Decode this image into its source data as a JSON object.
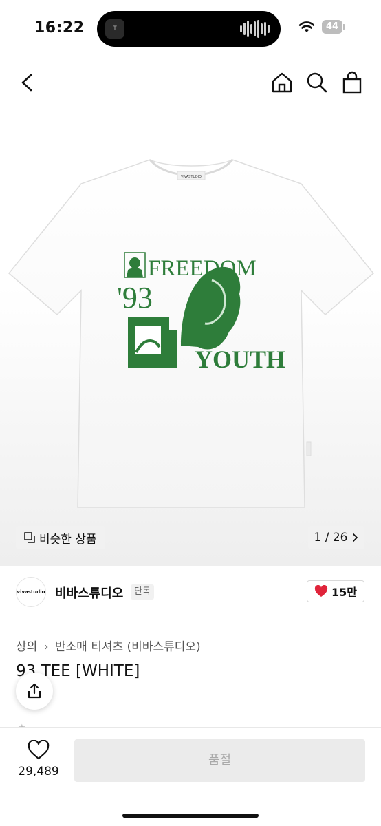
{
  "status_bar": {
    "time": "16:22",
    "battery": "44",
    "wifi_icon": "wifi-icon",
    "island_app_label": "T"
  },
  "nav": {
    "back_icon": "chevron-left-icon",
    "home_icon": "home-icon",
    "search_icon": "search-icon",
    "bag_icon": "shopping-bag-icon"
  },
  "product_image": {
    "neck_label": "VIVASTUDIO",
    "print_text_top": "FREEDOM",
    "print_number": "'93",
    "print_text_bottom": "YOUTH",
    "print_color": "#2e7d3a"
  },
  "image_overlay": {
    "similar_label": "비슷한 상품",
    "pager": "1 / 26"
  },
  "brand": {
    "logo_text": "vivastudio",
    "name": "비바스튜디오",
    "badge": "단독",
    "like_count": "15만"
  },
  "breadcrumb": {
    "items": [
      "상의",
      "반소매 티셔츠 (비바스튜디오)"
    ]
  },
  "product": {
    "title": "93 TEE [WHITE]"
  },
  "bottom_bar": {
    "wish_count": "29,489",
    "buy_label": "품절"
  },
  "colors": {
    "like_heart": "#e0243a",
    "print_green": "#2e7d3a"
  }
}
